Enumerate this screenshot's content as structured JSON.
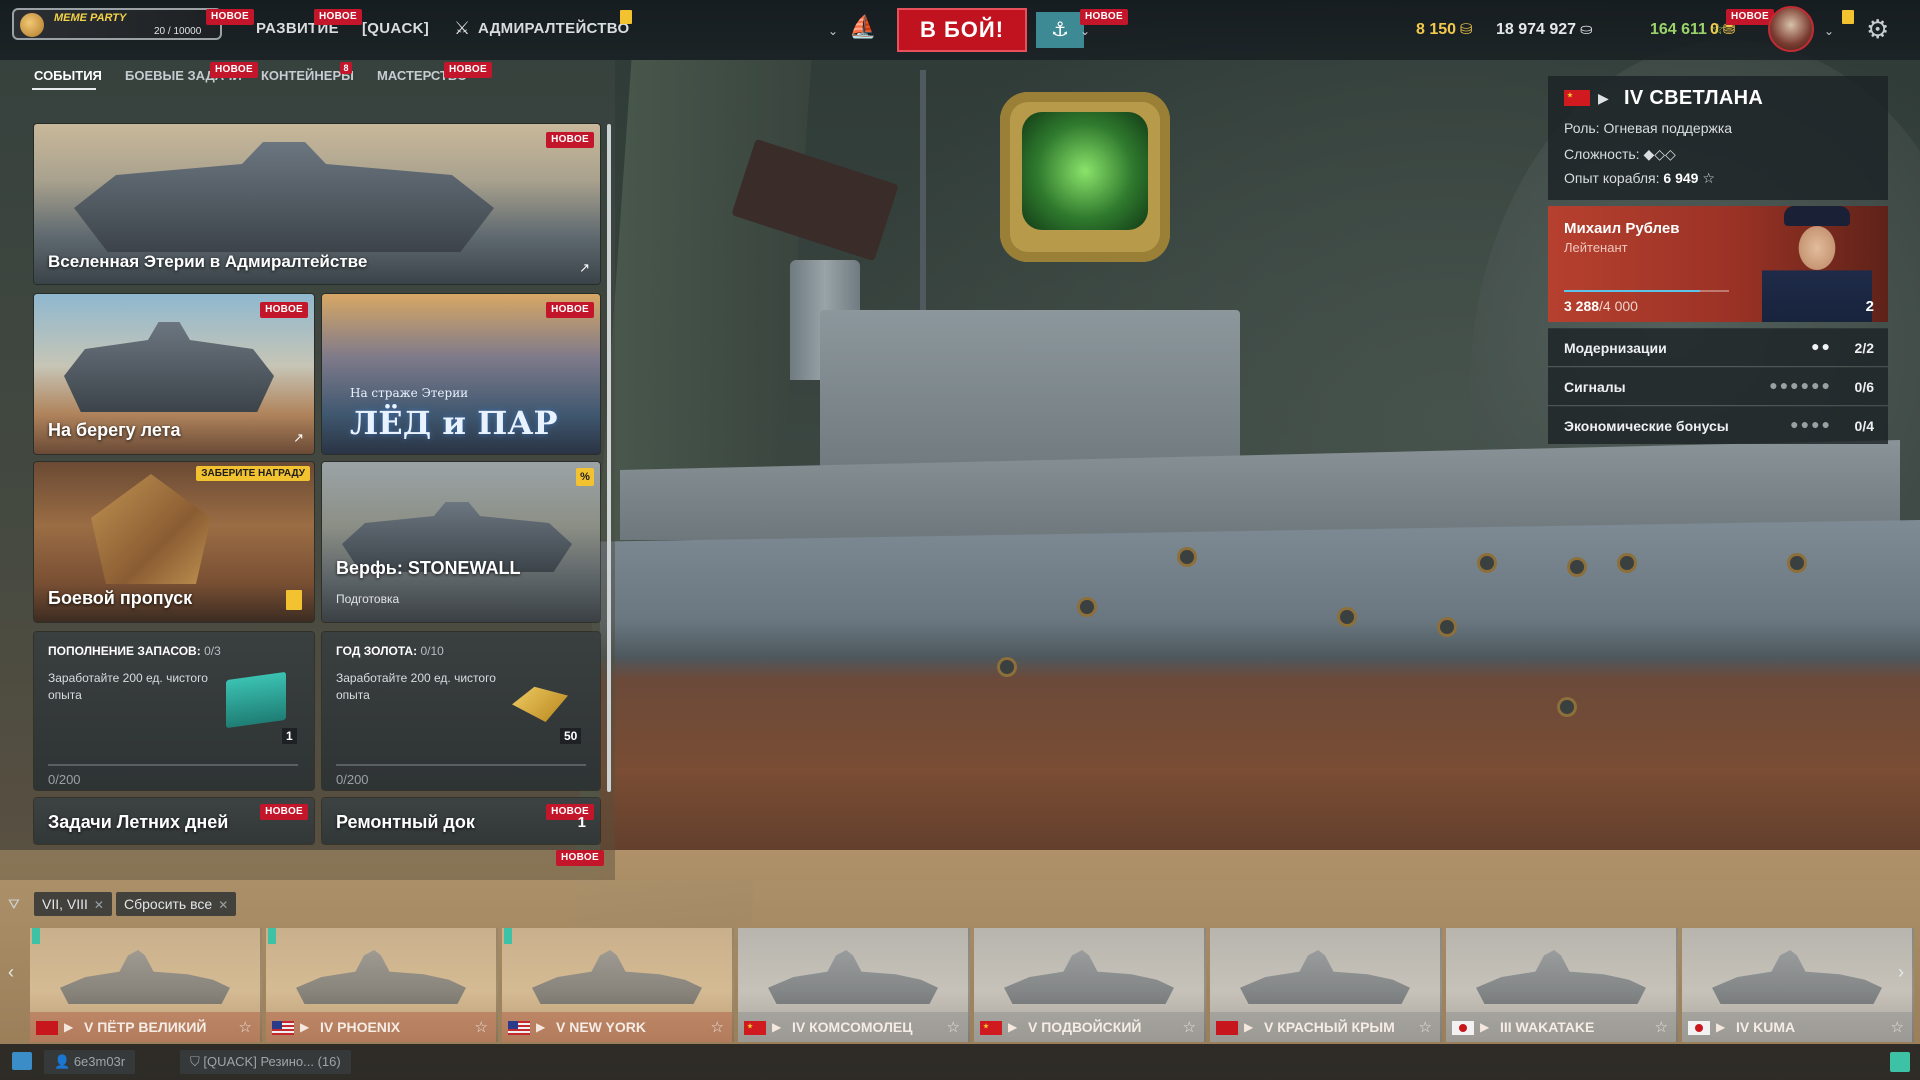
{
  "topbar": {
    "logo_name": "MEME PARTY",
    "logo_count": "20 / 10000",
    "logo_new": "НОВОЕ",
    "nav": [
      {
        "label": "РАЗВИТИЕ",
        "badge": "НОВОЕ"
      },
      {
        "label": "[QUACK]",
        "badge": ""
      },
      {
        "label": "АДМИРАЛТЕЙСТВО",
        "badge": ""
      }
    ],
    "battle_label": "В БОЙ!",
    "ship_select_badge": "НОВОЕ",
    "resources": [
      {
        "value": "8 150",
        "icon": "doubloon-icon",
        "color": "#f2c94c"
      },
      {
        "value": "18 974 927",
        "icon": "credits-icon",
        "color": "#e6e8ea"
      },
      {
        "value": "164 611",
        "icon": "free-xp-icon",
        "color": "#9bd36a"
      },
      {
        "value": "0",
        "icon": "coal-icon",
        "color": "#f2c94c"
      }
    ],
    "avatar_badge": "НОВОЕ"
  },
  "tabs": [
    {
      "label": "СОБЫТИЯ",
      "active": true,
      "badge": ""
    },
    {
      "label": "БОЕВЫЕ ЗАДАЧИ",
      "active": false,
      "badge": "НОВОЕ"
    },
    {
      "label": "КОНТЕЙНЕРЫ",
      "active": false,
      "badge": "8"
    },
    {
      "label": "МАСТЕРСТВО",
      "active": false,
      "badge": "НОВОЕ"
    }
  ],
  "events": {
    "eteria": {
      "title": "Вселенная Этерии в Адмиралтействе",
      "badge": "НОВОЕ"
    },
    "summer": {
      "title": "На берегу лета",
      "badge": "НОВОЕ"
    },
    "ice": {
      "badge": "НОВОЕ",
      "logo_small": "На страже Этерии",
      "logo_big": "ЛЁД и ПАР"
    },
    "battlepass": {
      "title": "Боевой пропуск",
      "badge": "ЗАБЕРИТЕ НАГРАДУ"
    },
    "shipyard": {
      "title": "Верфь: STONEWALL",
      "subtitle": "Подготовка",
      "badge": "%"
    },
    "resupply": {
      "head": "ПОПОЛНЕНИЕ ЗАПАСОВ:",
      "progress": "0/3",
      "desc": "Заработайте 200 ед. чистого опыта",
      "value": "0/200",
      "qty": "1"
    },
    "gold_year": {
      "head": "ГОД ЗОЛОТА:",
      "progress": "0/10",
      "desc": "Заработайте 200 ед. чистого опыта",
      "value": "0/200",
      "qty": "50"
    },
    "summer_tasks": {
      "title": "Задачи Летних дней",
      "badge": "НОВОЕ"
    },
    "repair_dock": {
      "title": "Ремонтный док",
      "badge": "НОВОЕ",
      "count": "1"
    },
    "next_badge": "НОВОЕ"
  },
  "ship_panel": {
    "tier": "IV",
    "name": "СВЕТЛАНА",
    "role_label": "Роль:",
    "role_value": "Огневая поддержка",
    "difficulty_label": "Сложность:",
    "difficulty_value": "◆◇◇",
    "xp_label": "Опыт корабля:",
    "xp_value": "6 949",
    "commander": {
      "name": "Михаил Рублев",
      "rank": "Лейтенант",
      "xp": "3 288",
      "xp_max": "/4 000",
      "xp_fraction": 0.822,
      "level": "2"
    },
    "slots": [
      {
        "label": "Модернизации",
        "dots": "●●",
        "on": true,
        "count": "2/2"
      },
      {
        "label": "Сигналы",
        "dots": "●●●●●●",
        "on": false,
        "count": "0/6"
      },
      {
        "label": "Экономические бонусы",
        "dots": "●●●●",
        "on": false,
        "count": "0/4"
      }
    ]
  },
  "filters": {
    "chips": [
      {
        "label": "VII, VIII"
      },
      {
        "label": "Сбросить все"
      }
    ]
  },
  "carousel": [
    {
      "tier": "V",
      "name": "ПЁТР ВЕЛИКИЙ",
      "nation": "su",
      "gray": false
    },
    {
      "tier": "IV",
      "name": "PHOENIX",
      "nation": "us",
      "gray": false
    },
    {
      "tier": "V",
      "name": "NEW YORK",
      "nation": "us",
      "gray": false
    },
    {
      "tier": "IV",
      "name": "КОМСОМОЛЕЦ",
      "nation": "cn",
      "gray": true
    },
    {
      "tier": "V",
      "name": "ПОДВОЙСКИЙ",
      "nation": "cn",
      "gray": true
    },
    {
      "tier": "V",
      "name": "КРАСНЫЙ КРЫМ",
      "nation": "su",
      "gray": true
    },
    {
      "tier": "III",
      "name": "WAKATAKE",
      "nation": "jp",
      "gray": true
    },
    {
      "tier": "IV",
      "name": "KUMA",
      "nation": "jp",
      "gray": true
    }
  ],
  "chat": {
    "tabs": [
      {
        "label": "6e3m03r"
      },
      {
        "label": "[QUACK] Резино... (16)"
      }
    ]
  }
}
